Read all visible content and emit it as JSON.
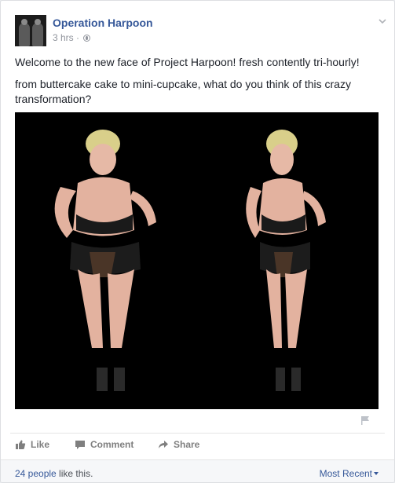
{
  "post": {
    "page_name": "Operation Harpoon",
    "timestamp": "3 hrs",
    "meta_separator": "·",
    "privacy_icon": "globe-icon",
    "menu_icon": "chevron-down-icon",
    "text_line1": "Welcome to the new face of Project Harpoon! fresh contently tri-hourly!",
    "text_line2": "from buttercake cake to mini-cupcake, what do you think of this crazy transformation?",
    "photo_description_icon": "photo",
    "report_icon": "flag-icon"
  },
  "actions": {
    "like_label": "Like",
    "comment_label": "Comment",
    "share_label": "Share"
  },
  "footer": {
    "likes_count_link": "24 people",
    "likes_suffix": " like this.",
    "sort_label": "Most Recent"
  },
  "colors": {
    "link_blue": "#365899",
    "muted_gray": "#90949c",
    "action_gray": "#7f7f7f",
    "photo_background": "#000000"
  }
}
